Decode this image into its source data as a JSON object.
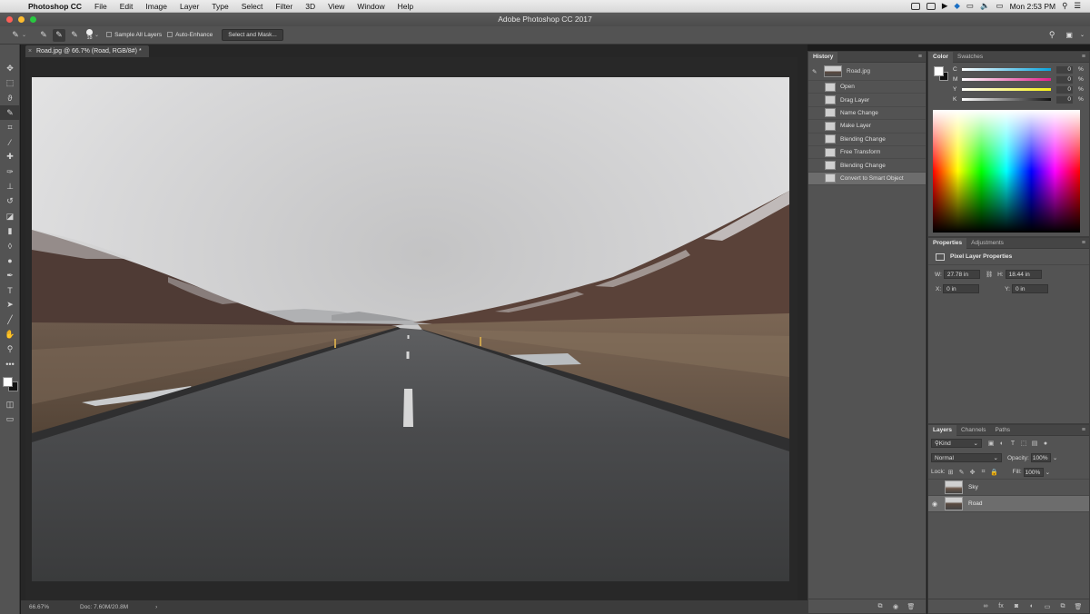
{
  "menubar": {
    "app_name": "Photoshop CC",
    "items": [
      "File",
      "Edit",
      "Image",
      "Layer",
      "Type",
      "Select",
      "Filter",
      "3D",
      "View",
      "Window",
      "Help"
    ],
    "clock": "Mon 2:53 PM"
  },
  "window": {
    "title": "Adobe Photoshop CC 2017"
  },
  "options_bar": {
    "brush_size": "18",
    "sample_all_layers": "Sample All Layers",
    "auto_enhance": "Auto-Enhance",
    "select_and_mask": "Select and Mask..."
  },
  "document": {
    "tab_title": "Road.jpg @ 66.7% (Road, RGB/8#) *",
    "zoom": "66.67%",
    "doc_size": "Doc: 7.60M/20.8M"
  },
  "history": {
    "tab": "History",
    "snapshot": "Road.jpg",
    "states": [
      "Open",
      "Drag Layer",
      "Name Change",
      "Make Layer",
      "Blending Change",
      "Free Transform",
      "Blending Change",
      "Convert to Smart Object"
    ],
    "active_index": 7
  },
  "color": {
    "tabs": [
      "Color",
      "Swatches"
    ],
    "channels": [
      {
        "label": "C",
        "value": "0"
      },
      {
        "label": "M",
        "value": "0"
      },
      {
        "label": "Y",
        "value": "0"
      },
      {
        "label": "K",
        "value": "0"
      }
    ],
    "percent": "%"
  },
  "properties": {
    "tabs": [
      "Properties",
      "Adjustments"
    ],
    "heading": "Pixel Layer Properties",
    "w_label": "W:",
    "w": "27.78 in",
    "h_label": "H:",
    "h": "18.44 in",
    "x_label": "X:",
    "x": "0 in",
    "y_label": "Y:",
    "y": "0 in"
  },
  "layers": {
    "tabs": [
      "Layers",
      "Channels",
      "Paths"
    ],
    "filter": "Kind",
    "blend_mode": "Normal",
    "opacity_label": "Opacity:",
    "opacity": "100%",
    "lock_label": "Lock:",
    "fill_label": "Fill:",
    "fill": "100%",
    "items": [
      {
        "name": "Sky",
        "visible": false
      },
      {
        "name": "Road",
        "visible": true
      }
    ],
    "selected": "Road"
  },
  "colors": {
    "panel": "#535353",
    "canvas": "#282828",
    "selection": "#6d6d6d"
  }
}
